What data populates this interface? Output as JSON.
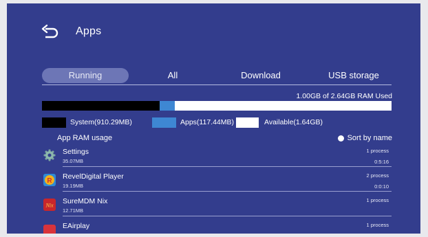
{
  "header": {
    "title": "Apps",
    "back_icon": "back-arrow-icon"
  },
  "tabs": [
    {
      "label": "Running",
      "active": true
    },
    {
      "label": "All",
      "active": false
    },
    {
      "label": "Download",
      "active": false
    },
    {
      "label": "USB storage",
      "active": false
    }
  ],
  "ram": {
    "used_text": "1.00GB of 2.64GB RAM Used",
    "system_fraction": 0.337,
    "apps_fraction": 0.043,
    "colors": {
      "system": "#000000",
      "apps": "#3e87d3",
      "available": "#ffffff"
    }
  },
  "legend": [
    {
      "label": "System(910.29MB)",
      "color": "#000000"
    },
    {
      "label": "Apps(117.44MB)",
      "color": "#3e87d3"
    },
    {
      "label": "Available(1.64GB)",
      "color": "#ffffff"
    }
  ],
  "list": {
    "section_label": "App RAM usage",
    "sort_label": "Sort by name",
    "apps": [
      {
        "name": "Settings",
        "size": "35.07MB",
        "process": "1 process",
        "time": "0:5:16",
        "icon": "settings-gear-icon"
      },
      {
        "name": "RevelDigital Player",
        "size": "19.19MB",
        "process": "2 process",
        "time": "0:0:10",
        "icon": "reveldigital-icon"
      },
      {
        "name": "SureMDM Nix",
        "size": "12.71MB",
        "process": "1 process",
        "time": "",
        "icon": "suremdm-icon"
      },
      {
        "name": "EAirplay",
        "size": "",
        "process": "1 process",
        "time": "",
        "icon": "eairplay-icon"
      }
    ]
  }
}
